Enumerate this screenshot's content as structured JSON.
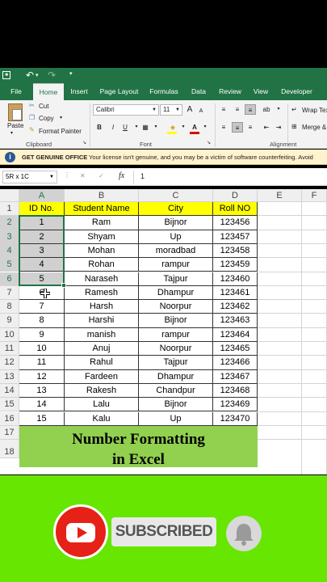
{
  "titlebar": {
    "undo_icon": "undo-icon",
    "redo_icon": "redo-icon"
  },
  "tabs": [
    {
      "label": "File"
    },
    {
      "label": "Home"
    },
    {
      "label": "Insert"
    },
    {
      "label": "Page Layout"
    },
    {
      "label": "Formulas"
    },
    {
      "label": "Data"
    },
    {
      "label": "Review"
    },
    {
      "label": "View"
    },
    {
      "label": "Developer"
    }
  ],
  "ribbon": {
    "clipboard": {
      "paste": "Paste",
      "cut": "Cut",
      "copy": "Copy",
      "format_painter": "Format Painter",
      "group": "Clipboard"
    },
    "font": {
      "name": "Calibri",
      "size": "11",
      "bold": "B",
      "italic": "I",
      "underline": "U",
      "font_color_letter": "A",
      "grow": "A",
      "shrink": "A",
      "group": "Font"
    },
    "alignment": {
      "wrap": "Wrap Text",
      "merge": "Merge &",
      "group": "Alignment"
    }
  },
  "message_bar": {
    "title": "GET GENUINE OFFICE",
    "text": "Your license isn't genuine, and you may be a victim of software counterfeiting. Avoid"
  },
  "formula_bar": {
    "name_box": "5R x 1C",
    "fx": "fx",
    "value": "1"
  },
  "columns": [
    "A",
    "B",
    "C",
    "D",
    "E",
    "F"
  ],
  "rows": [
    "1",
    "2",
    "3",
    "4",
    "5",
    "6",
    "7",
    "8",
    "9",
    "10",
    "11",
    "12",
    "13",
    "14",
    "15",
    "16",
    "17",
    "18"
  ],
  "table": {
    "headers": [
      "ID No.",
      "Student Name",
      "City",
      "Roll NO"
    ],
    "data": [
      [
        "1",
        "Ram",
        "Bijnor",
        "123456"
      ],
      [
        "2",
        "Shyam",
        "Up",
        "123457"
      ],
      [
        "3",
        "Mohan",
        "moradbad",
        "123458"
      ],
      [
        "4",
        "Rohan",
        "rampur",
        "123459"
      ],
      [
        "5",
        "Naraseh",
        "Tajpur",
        "123460"
      ],
      [
        "6",
        "Ramesh",
        "Dhampur",
        "123461"
      ],
      [
        "7",
        "Harsh",
        "Noorpur",
        "123462"
      ],
      [
        "8",
        "Harshi",
        "Bijnor",
        "123463"
      ],
      [
        "9",
        "manish",
        "rampur",
        "123464"
      ],
      [
        "10",
        "Anuj",
        "Noorpur",
        "123465"
      ],
      [
        "11",
        "Rahul",
        "Tajpur",
        "123466"
      ],
      [
        "12",
        "Fardeen",
        "Dhampur",
        "123467"
      ],
      [
        "13",
        "Rakesh",
        "Chandpur",
        "123468"
      ],
      [
        "14",
        "Lalu",
        "Bijnor",
        "123469"
      ],
      [
        "15",
        "Kalu",
        "Up",
        "123470"
      ]
    ]
  },
  "caption": {
    "line1": "Number Formatting",
    "line2": "in Excel"
  },
  "banner": {
    "subscribed": "SUBSCRIBED",
    "youtube_icon": "youtube-icon",
    "bell_icon": "bell-icon"
  },
  "colors": {
    "excel_green": "#217346",
    "header_yellow": "#ffff00",
    "caption_green": "#92d050",
    "banner_green": "#66e600",
    "youtube_red": "#e62117"
  }
}
